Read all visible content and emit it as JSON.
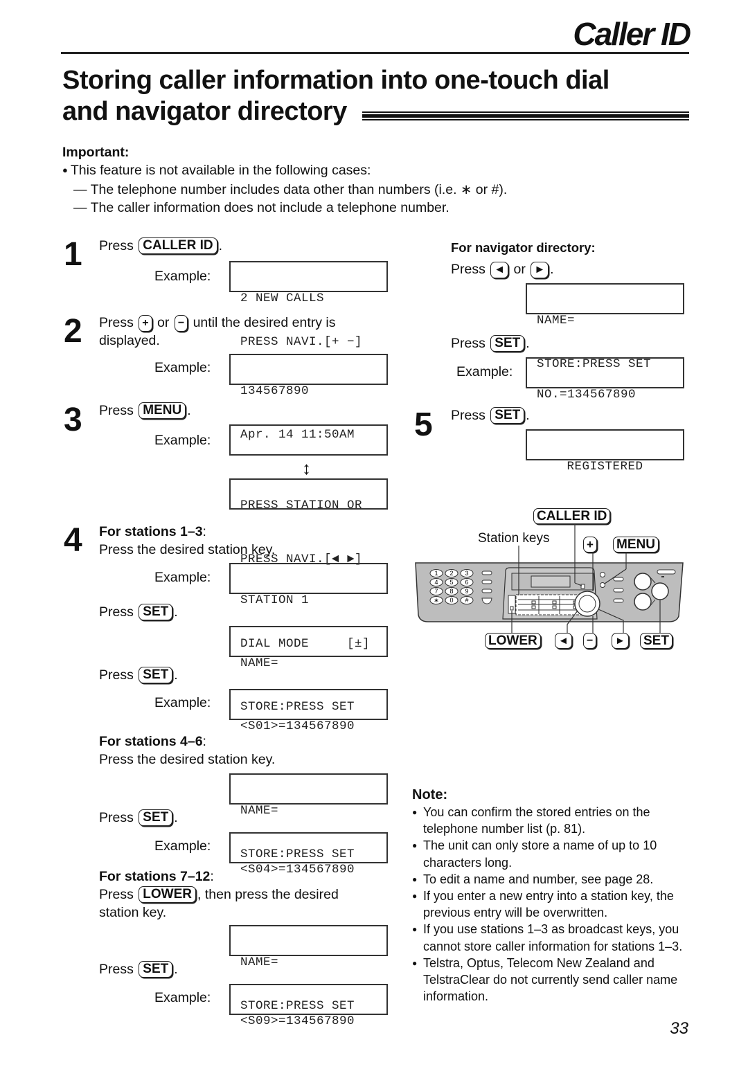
{
  "header": {
    "section": "Caller ID",
    "title_line1": "Storing caller information into one-touch dial",
    "title_line2": "and navigator directory"
  },
  "important": {
    "heading": "Important:",
    "bullet": "This feature is not available in the following cases:",
    "cases": [
      "— The telephone number includes data other than numbers (i.e.  ∗  or #).",
      "— The caller information does not include a telephone number."
    ]
  },
  "keys": {
    "caller_id": "CALLER ID",
    "plus": "+",
    "minus": "−",
    "menu": "MENU",
    "set": "SET",
    "lower": "LOWER",
    "left": "◄",
    "right": "►"
  },
  "common": {
    "press": "Press",
    "or": "or",
    "period": ".",
    "example": "Example:",
    "colon": ":"
  },
  "steps": {
    "s1": {
      "num": "1",
      "lcd": [
        "2 NEW CALLS",
        "PRESS NAVI.[+ −]"
      ]
    },
    "s2": {
      "num": "2",
      "text_after": "until the desired entry is",
      "text_line2": "displayed.",
      "lcd": [
        "134567890",
        "Apr. 14 11:50AM"
      ]
    },
    "s3": {
      "num": "3",
      "lcd_a": [
        "",
        "PRESS STATION OR"
      ],
      "lcd_b": [
        "",
        "PRESS NAVI.[◄ ►]"
      ],
      "arrow": "↕"
    },
    "s4": {
      "num": "4",
      "st13_heading": "For stations 1–3",
      "st13_text": "Press the desired station key.",
      "st13_lcd": [
        "STATION 1",
        "DIAL MODE     [±]"
      ],
      "name_lcd": [
        "NAME=",
        "STORE:PRESS SET"
      ],
      "st13_result_lcd": [
        "<S01>=134567890",
        ""
      ],
      "st46_heading": "For stations 4–6",
      "st46_text": "Press the desired station key.",
      "st46_result_lcd": [
        "<S04>=134567890",
        ""
      ],
      "st712_heading": "For stations 7–12",
      "st712_text_after": ", then press the desired",
      "st712_text_line2": "station key.",
      "st712_result_lcd": [
        "<S09>=134567890",
        ""
      ]
    },
    "nav": {
      "heading": "For navigator directory:",
      "lcd": [
        "NAME=",
        "STORE:PRESS SET"
      ],
      "result_lcd": [
        "NO.=134567890",
        ""
      ]
    },
    "s5": {
      "num": "5",
      "lcd": [
        "REGISTERED",
        ""
      ]
    }
  },
  "diagram": {
    "station_keys_label": "Station keys",
    "keypad": [
      "1",
      "2",
      "3",
      "4",
      "5",
      "6",
      "7",
      "8",
      "9",
      "∗",
      "0",
      "#"
    ]
  },
  "note": {
    "heading": "Note:",
    "items": [
      "You can confirm the stored entries on the telephone number list (p. 81).",
      "The unit can only store a name of up to 10 characters long.",
      "To edit a name and number, see page 28.",
      "If you enter a new entry into a station key, the previous entry will be overwritten.",
      "If you use stations 1–3 as broadcast keys, you cannot store caller information for stations 1–3.",
      "Telstra, Optus, Telecom New Zealand and TelstraClear do not currently send caller name information."
    ]
  },
  "page_number": "33"
}
